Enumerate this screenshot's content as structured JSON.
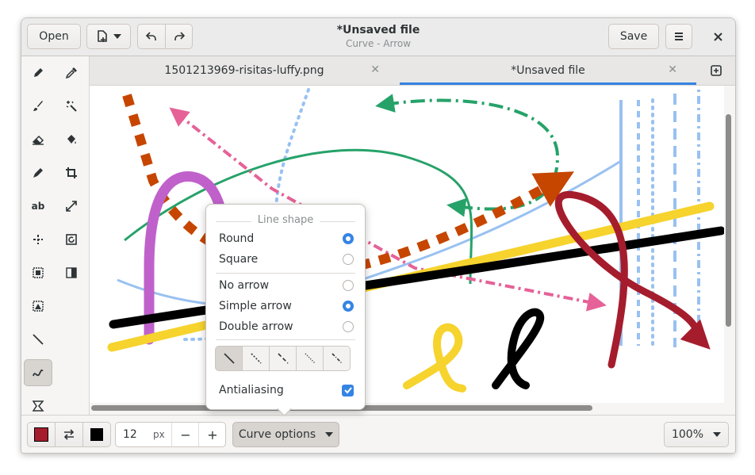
{
  "header": {
    "open_label": "Open",
    "title": "*Unsaved file",
    "subtitle": "Curve - Arrow",
    "save_label": "Save"
  },
  "tabs": [
    {
      "label": "1501213969-risitas-luffy.png",
      "active": false
    },
    {
      "label": "*Unsaved file",
      "active": true
    }
  ],
  "tools": [
    {
      "name": "pencil"
    },
    {
      "name": "color-picker"
    },
    {
      "name": "paint-brush"
    },
    {
      "name": "magic-wand-select"
    },
    {
      "name": "eraser"
    },
    {
      "name": "fill-bucket"
    },
    {
      "name": "highlighter"
    },
    {
      "name": "crop"
    },
    {
      "name": "text",
      "label": "ab"
    },
    {
      "name": "scale"
    },
    {
      "name": "free-select"
    },
    {
      "name": "rotate"
    },
    {
      "name": "rect-select"
    },
    {
      "name": "filters"
    },
    {
      "name": "canvas-select"
    },
    {
      "name": "line"
    },
    {
      "name": "curve",
      "active": true
    },
    {
      "name": "free-shape"
    }
  ],
  "bottom": {
    "main_color": "#a51d2d",
    "secondary_color": "#000000",
    "size_value": "12",
    "size_unit": "px",
    "minus": "−",
    "plus": "+",
    "options_label": "Curve options",
    "zoom_label": "100%"
  },
  "popover": {
    "line_shape_heading": "Line shape",
    "round_label": "Round",
    "square_label": "Square",
    "no_arrow_label": "No arrow",
    "simple_arrow_label": "Simple arrow",
    "double_arrow_label": "Double arrow",
    "antialiasing_label": "Antialiasing",
    "selected_shape": "Round",
    "selected_arrow": "Simple arrow",
    "antialiasing": true,
    "dash_styles": [
      "solid",
      "dashed",
      "dash-long",
      "dotted",
      "dash-dot"
    ],
    "selected_dash": "solid"
  },
  "colors": {
    "accent": "#3584e4",
    "canvas_strokes": [
      "#c061cb",
      "#000000",
      "#f6d32d",
      "#c64600",
      "#26a269",
      "#e66197",
      "#99c1f1",
      "#a51d2d"
    ]
  }
}
